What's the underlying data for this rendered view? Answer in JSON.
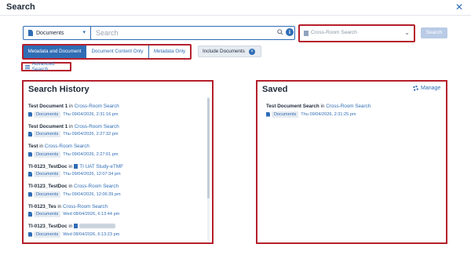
{
  "window": {
    "title": "Search",
    "close_icon": "close-icon"
  },
  "search_bar": {
    "scope_label": "Documents",
    "placeholder": "Search",
    "room_placeholder": "Cross-Room Search",
    "search_button": "Search"
  },
  "filters": {
    "toggles": [
      "Metadata and Document",
      "Document Content Only",
      "Metadata Only"
    ],
    "active_toggle": "Metadata and Document",
    "include_pill": "Include Documents",
    "advanced_search": "Advanced Search"
  },
  "history": {
    "title": "Search History",
    "entries": [
      {
        "name": "Test Document 1",
        "in": "in",
        "location": "Cross-Room Search",
        "badge": "Documents",
        "date": "Thu 09/04/2026, 2:31:16 pm"
      },
      {
        "name": "Test Document 1",
        "in": "in",
        "location": "Cross-Room Search",
        "badge": "Documents",
        "date": "Thu 09/04/2026, 2:27:32 pm"
      },
      {
        "name": "Test",
        "in": "in",
        "location": "Cross-Room Search",
        "badge": "Documents",
        "date": "Thu 09/04/2026, 2:27:01 pm"
      },
      {
        "name": "TI-0123_TestDoc",
        "in": "in",
        "location": "TI UAT Study-eTMF",
        "badge": "Documents",
        "date": "Thu 09/04/2026, 12:07:34 pm"
      },
      {
        "name": "TI-0123_TestDoc",
        "in": "in",
        "location": "Cross-Room Search",
        "badge": "Documents",
        "date": "Thu 09/04/2026, 12:06:39 pm"
      },
      {
        "name": "TI-0123_Tes",
        "in": "in",
        "location": "Cross-Room Search",
        "badge": "Documents",
        "date": "Wed 08/04/2026, 6:13:44 pm"
      },
      {
        "name": "TI-0123_TestDoc",
        "in": "in",
        "location": "",
        "badge": "Documents",
        "date": "Wed 08/04/2026, 6:13:23 pm"
      }
    ]
  },
  "saved": {
    "title": "Saved",
    "manage_label": "Manage",
    "entries": [
      {
        "name": "Test Document Search",
        "in": "in",
        "location": "Cross-Room Search",
        "badge": "Documents",
        "date": "Thu 09/04/2026, 2:31:25 pm"
      }
    ]
  },
  "colors": {
    "accent": "#2f6db5",
    "highlight_border": "#b5202c",
    "badge_bg": "#e6ebf1"
  }
}
